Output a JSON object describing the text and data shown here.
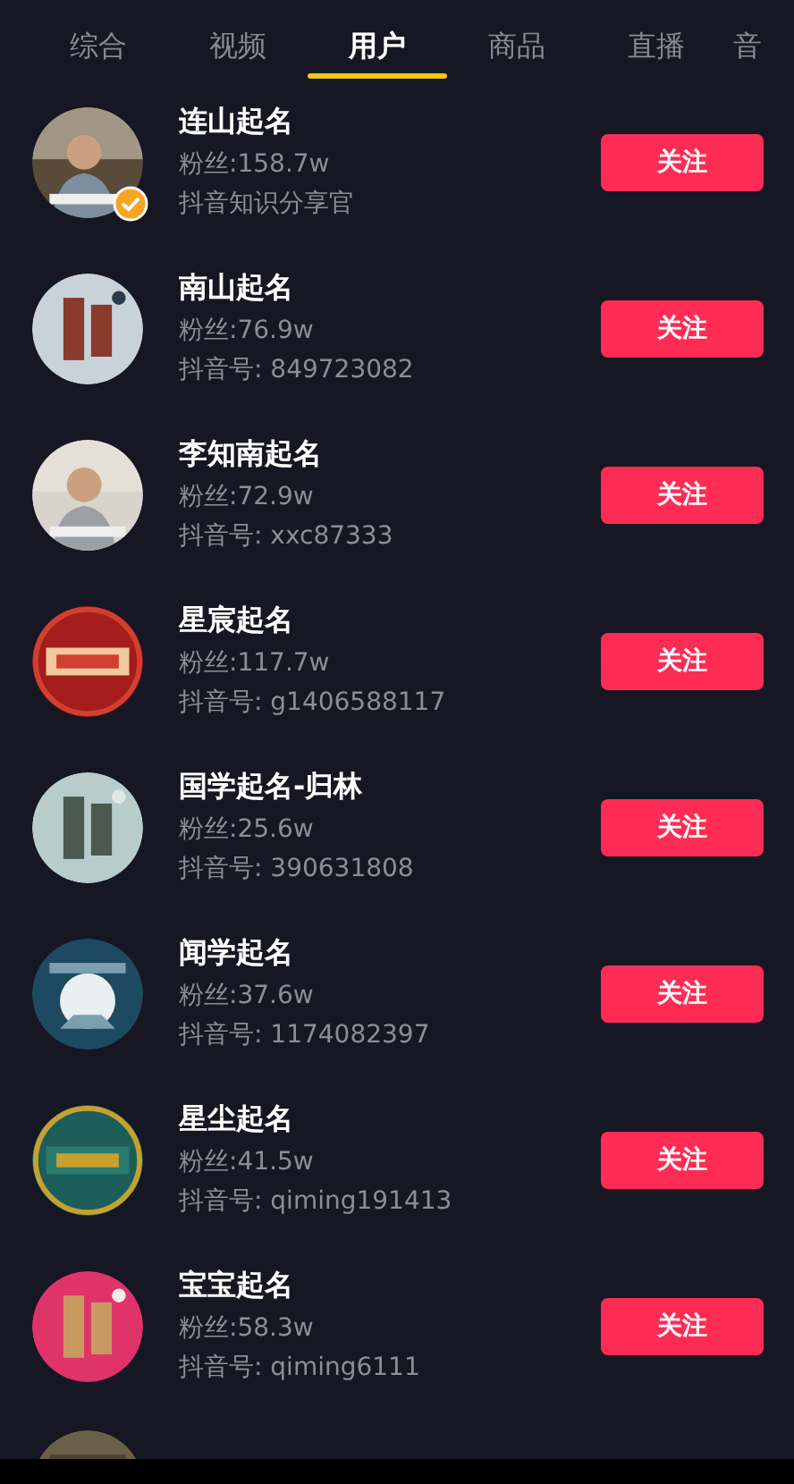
{
  "tabs": [
    {
      "label": "综合",
      "selected": false
    },
    {
      "label": "视频",
      "selected": false
    },
    {
      "label": "用户",
      "selected": true
    },
    {
      "label": "商品",
      "selected": false
    },
    {
      "label": "直播",
      "selected": false
    },
    {
      "label": "音",
      "selected": false
    }
  ],
  "users": [
    {
      "name": "连山起名",
      "fans": "粉丝:158.7w",
      "detail": "抖音知识分享官",
      "verified": true,
      "button": "关注"
    },
    {
      "name": "南山起名",
      "fans": "粉丝:76.9w",
      "detail": "抖音号: 849723082",
      "verified": false,
      "button": "关注"
    },
    {
      "name": "李知南起名",
      "fans": "粉丝:72.9w",
      "detail": "抖音号: xxc87333",
      "verified": false,
      "button": "关注"
    },
    {
      "name": "星宸起名",
      "fans": "粉丝:117.7w",
      "detail": "抖音号: g1406588117",
      "verified": false,
      "button": "关注"
    },
    {
      "name": "国学起名-归林",
      "fans": "粉丝:25.6w",
      "detail": "抖音号: 390631808",
      "verified": false,
      "button": "关注"
    },
    {
      "name": "闻学起名",
      "fans": "粉丝:37.6w",
      "detail": "抖音号: 1174082397",
      "verified": false,
      "button": "关注"
    },
    {
      "name": "星尘起名",
      "fans": "粉丝:41.5w",
      "detail": "抖音号: qiming191413",
      "verified": false,
      "button": "关注"
    },
    {
      "name": "宝宝起名",
      "fans": "粉丝:58.3w",
      "detail": "抖音号: qiming6111",
      "verified": false,
      "button": "关注"
    }
  ]
}
